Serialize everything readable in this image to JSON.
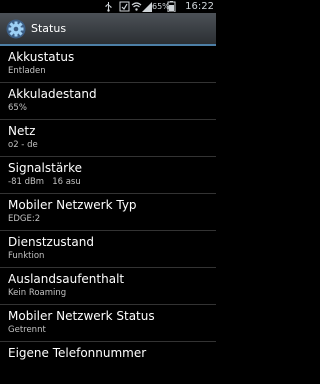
{
  "status_bar": {
    "icons": [
      "usb-icon",
      "notification-icon",
      "wifi-icon",
      "signal-icon",
      "battery-icon"
    ],
    "battery_percent": "65%",
    "time": "16:22"
  },
  "title_bar": {
    "icon": "settings-gear-icon",
    "title": "Status"
  },
  "items": [
    {
      "label": "Akkustatus",
      "value": "Entladen"
    },
    {
      "label": "Akkuladestand",
      "value": "65%"
    },
    {
      "label": "Netz",
      "value": "o2 - de"
    },
    {
      "label": "Signalstärke",
      "value": "-81 dBm   16 asu"
    },
    {
      "label": "Mobiler Netzwerk Typ",
      "value": "EDGE:2"
    },
    {
      "label": "Dienstzustand",
      "value": "Funktion"
    },
    {
      "label": "Auslandsaufenthalt",
      "value": "Kein Roaming"
    },
    {
      "label": "Mobiler Netzwerk Status",
      "value": "Getrennt"
    },
    {
      "label": "Eigene Telefonnummer",
      "value": ""
    }
  ]
}
